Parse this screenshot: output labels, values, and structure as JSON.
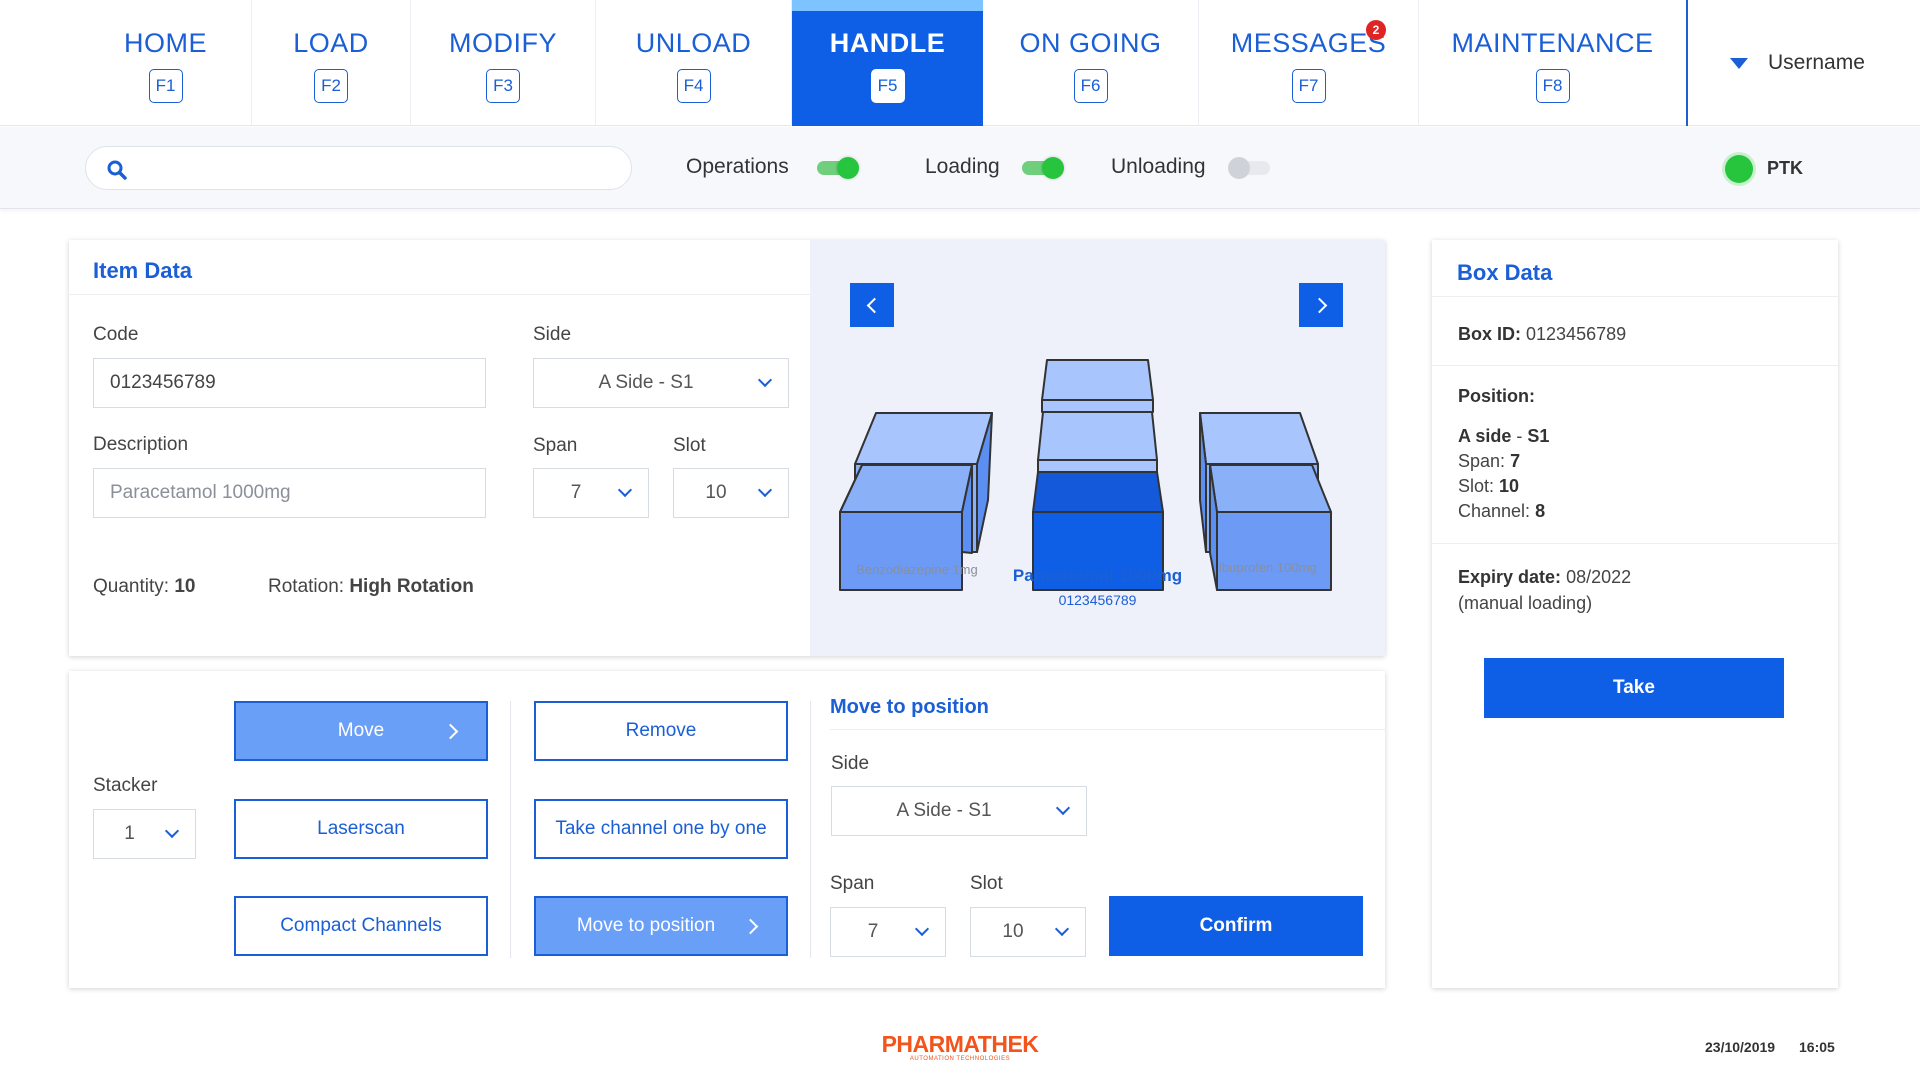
{
  "nav": {
    "tabs": [
      {
        "label": "HOME",
        "key": "F1"
      },
      {
        "label": "LOAD",
        "key": "F2"
      },
      {
        "label": "MODIFY",
        "key": "F3"
      },
      {
        "label": "UNLOAD",
        "key": "F4"
      },
      {
        "label": "HANDLE",
        "key": "F5",
        "active": true
      },
      {
        "label": "ON GOING",
        "key": "F6"
      },
      {
        "label": "MESSAGES",
        "key": "F7",
        "badge": "2"
      },
      {
        "label": "MAINTENANCE",
        "key": "F8"
      }
    ],
    "username": "Username"
  },
  "toolbar": {
    "search_placeholder": "",
    "toggles": [
      {
        "label": "Operations",
        "on": true
      },
      {
        "label": "Loading",
        "on": true
      },
      {
        "label": "Unloading",
        "on": false
      }
    ],
    "status_label": "PTK",
    "status_color": "#27c53d"
  },
  "item_data": {
    "title": "Item Data",
    "code_label": "Code",
    "code_value": "0123456789",
    "side_label": "Side",
    "side_value": "A Side - S1",
    "description_label": "Description",
    "description_value": "Paracetamol 1000mg",
    "span_label": "Span",
    "span_value": "7",
    "slot_label": "Slot",
    "slot_value": "10",
    "quantity_label": "Quantity:",
    "quantity_value": "10",
    "rotation_label": "Rotation:",
    "rotation_value": "High Rotation"
  },
  "viewer": {
    "left_name": "Benzodiazepine 1mg",
    "center_name": "Paracetamol 1000mg",
    "center_code": "0123456789",
    "right_name": "Ibuprofen 100mg"
  },
  "actions": {
    "stacker_label": "Stacker",
    "stacker_value": "1",
    "move": "Move",
    "laserscan": "Laserscan",
    "compact": "Compact Channels",
    "remove": "Remove",
    "take_channel": "Take channel one by one",
    "move_to_position": "Move to position"
  },
  "move_position": {
    "title": "Move to position",
    "side_label": "Side",
    "side_value": "A Side - S1",
    "span_label": "Span",
    "span_value": "7",
    "slot_label": "Slot",
    "slot_value": "10",
    "confirm": "Confirm"
  },
  "box_data": {
    "title": "Box Data",
    "box_id_label": "Box ID:",
    "box_id_value": "0123456789",
    "position_label": "Position:",
    "side_prefix": "A side",
    "side_sep": " - ",
    "side_value": "S1",
    "span_label": "Span:",
    "span_value": "7",
    "slot_label": "Slot:",
    "slot_value": "10",
    "channel_label": "Channel:",
    "channel_value": "8",
    "expiry_label": "Expiry date:",
    "expiry_value": "08/2022",
    "expiry_note": "(manual loading)",
    "take": "Take"
  },
  "footer": {
    "logo": "PHARMATHEK",
    "logo_tagline": "AUTOMATION TECHNOLOGIES",
    "date": "23/10/2019",
    "time": "16:05"
  },
  "colors": {
    "primary": "#0f5fe6",
    "light_button": "#6a9ff8",
    "logo": "#f2541b"
  }
}
